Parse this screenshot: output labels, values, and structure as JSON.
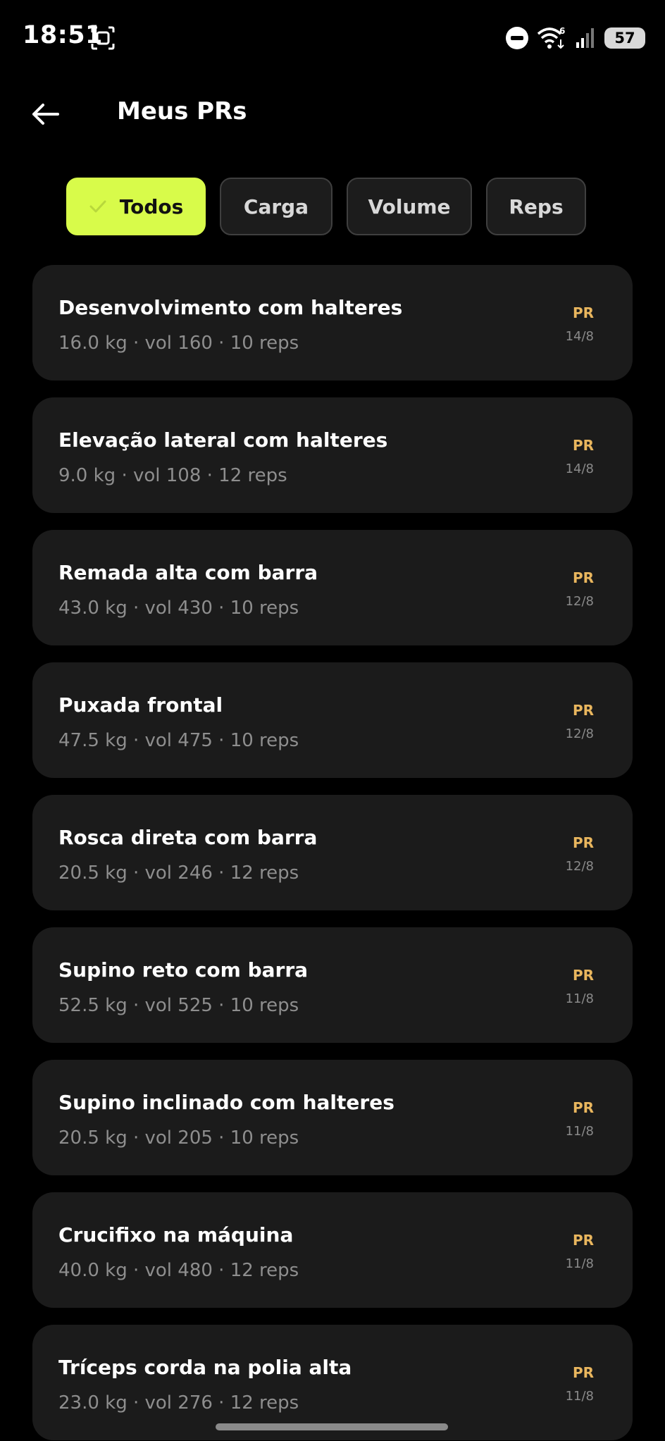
{
  "status_bar": {
    "time": "18:51",
    "wifi_badge": "6",
    "battery": "57"
  },
  "header": {
    "title": "Meus PRs"
  },
  "filters": [
    {
      "label": "Todos",
      "active": true
    },
    {
      "label": "Carga",
      "active": false
    },
    {
      "label": "Volume",
      "active": false
    },
    {
      "label": "Reps",
      "active": false
    }
  ],
  "colors": {
    "accent": "#d8fb4a",
    "pr_badge": "#e9b65e",
    "card_bg": "#1b1b1b",
    "background": "#000000"
  },
  "pr_badge_label": "PR",
  "records": [
    {
      "name": "Desenvolvimento com halteres",
      "details": "16.0 kg · vol 160 · 10 reps",
      "date": "14/8"
    },
    {
      "name": "Elevação lateral com halteres",
      "details": "9.0 kg · vol 108 · 12 reps",
      "date": "14/8"
    },
    {
      "name": "Remada alta com barra",
      "details": "43.0 kg · vol 430 · 10 reps",
      "date": "12/8"
    },
    {
      "name": "Puxada frontal",
      "details": "47.5 kg · vol 475 · 10 reps",
      "date": "12/8"
    },
    {
      "name": "Rosca direta com barra",
      "details": "20.5 kg · vol 246 · 12 reps",
      "date": "12/8"
    },
    {
      "name": "Supino reto com barra",
      "details": "52.5 kg · vol 525 · 10 reps",
      "date": "11/8"
    },
    {
      "name": "Supino inclinado com halteres",
      "details": "20.5 kg · vol 205 · 10 reps",
      "date": "11/8"
    },
    {
      "name": "Crucifixo na máquina",
      "details": "40.0 kg · vol 480 · 12 reps",
      "date": "11/8"
    },
    {
      "name": "Tríceps corda na polia alta",
      "details": "23.0 kg · vol 276 · 12 reps",
      "date": "11/8"
    }
  ]
}
